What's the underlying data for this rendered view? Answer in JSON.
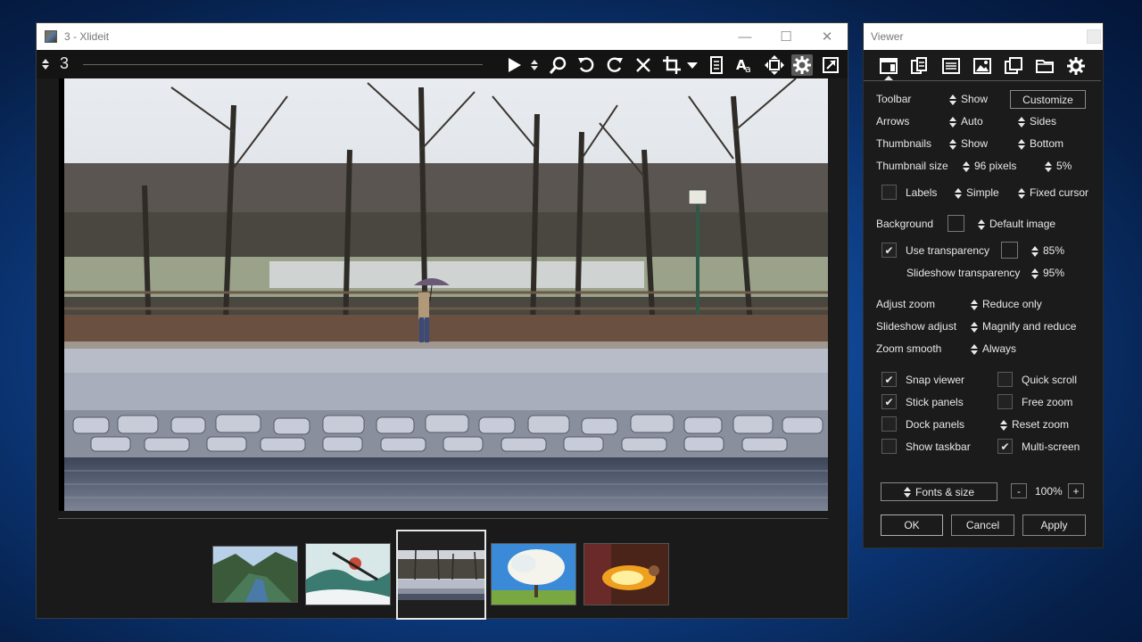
{
  "main_window": {
    "title": "3 - Xlideit",
    "controls": {
      "minimize": "—",
      "maximize": "☐",
      "close": "✕"
    },
    "toolbar": {
      "index": "3"
    },
    "thumbnails": [
      {
        "name": "fjord",
        "selected": false
      },
      {
        "name": "kayaker",
        "selected": false
      },
      {
        "name": "walker-by-canal",
        "selected": true
      },
      {
        "name": "blossom-tree",
        "selected": false
      },
      {
        "name": "fire-breather",
        "selected": false
      }
    ]
  },
  "viewer_panel": {
    "title": "Viewer",
    "settings": {
      "toolbar": {
        "label": "Toolbar",
        "value": "Show",
        "button": "Customize"
      },
      "arrows": {
        "label": "Arrows",
        "value": "Auto",
        "position": "Sides"
      },
      "thumbnails": {
        "label": "Thumbnails",
        "value": "Show",
        "position": "Bottom"
      },
      "thumbnail_size": {
        "label": "Thumbnail size",
        "pixels": "96 pixels",
        "percent": "5%"
      },
      "labels": {
        "label": "Labels",
        "checked": false,
        "style": "Simple",
        "cursor": "Fixed cursor"
      },
      "background": {
        "label": "Background",
        "image": "Default image"
      },
      "use_transparency": {
        "label": "Use transparency",
        "checked": true,
        "value": "85%"
      },
      "slideshow_transparency": {
        "label": "Slideshow transparency",
        "value": "95%"
      },
      "adjust_zoom": {
        "label": "Adjust zoom",
        "value": "Reduce only"
      },
      "slideshow_adjust": {
        "label": "Slideshow adjust",
        "value": "Magnify and reduce"
      },
      "zoom_smooth": {
        "label": "Zoom smooth",
        "value": "Always"
      },
      "snap_viewer": {
        "label": "Snap viewer",
        "checked": true
      },
      "quick_scroll": {
        "label": "Quick scroll",
        "checked": false
      },
      "stick_panels": {
        "label": "Stick panels",
        "checked": true
      },
      "free_zoom": {
        "label": "Free zoom",
        "checked": false
      },
      "dock_panels": {
        "label": "Dock panels",
        "checked": false
      },
      "reset_zoom": {
        "label": "Reset zoom"
      },
      "show_taskbar": {
        "label": "Show taskbar",
        "checked": false
      },
      "multi_screen": {
        "label": "Multi-screen",
        "checked": true
      }
    },
    "fonts": {
      "label": "Fonts & size",
      "minus": "-",
      "zoom": "100%",
      "plus": "+"
    },
    "buttons": {
      "ok": "OK",
      "cancel": "Cancel",
      "apply": "Apply"
    }
  },
  "colors": {
    "desktop": "#0b3574",
    "panel_bg": "#1b1b1b",
    "text": "#e8e8e8"
  }
}
